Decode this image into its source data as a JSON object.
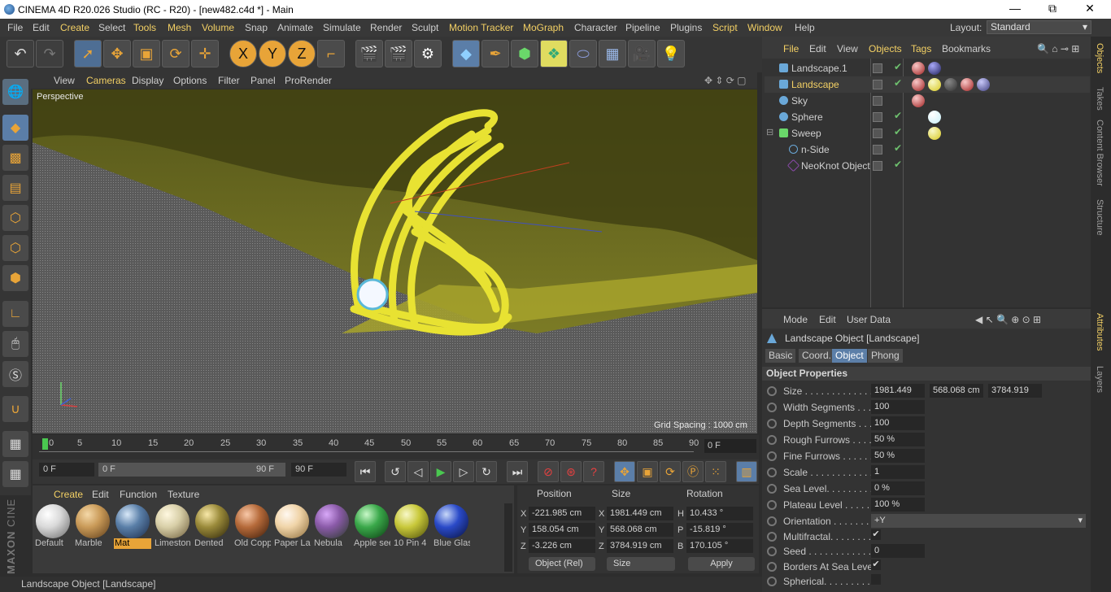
{
  "window": {
    "title": "CINEMA 4D R20.026 Studio (RC - R20) - [new482.c4d *] - Main",
    "minimize": "—",
    "restore": "⧉",
    "close": "✕"
  },
  "menubar": {
    "items": [
      "File",
      "Edit",
      "Create",
      "Select",
      "Tools",
      "Mesh",
      "Volume",
      "Snap",
      "Animate",
      "Simulate",
      "Render",
      "Sculpt",
      "Motion Tracker",
      "MoGraph",
      "Character",
      "Pipeline",
      "Plugins",
      "Script",
      "Window",
      "Help"
    ],
    "layout_label": "Layout:",
    "layout_value": "Standard"
  },
  "toolbar": {
    "icons": [
      "undo-icon",
      "redo-icon",
      "live-select-icon",
      "move-icon",
      "scale-icon",
      "rotate-icon",
      "last-tool-icon",
      "x-axis-icon",
      "y-axis-icon",
      "z-axis-icon",
      "coordinate-system-icon",
      "render-view-icon",
      "render-to-picture-viewer-icon",
      "edit-render-settings-icon",
      "cube-icon",
      "pen-icon",
      "subdivision-icon",
      "array-icon",
      "deformer-icon",
      "floor-icon",
      "camera-icon",
      "light-icon"
    ]
  },
  "viewport": {
    "menu": [
      "View",
      "Cameras",
      "Display",
      "Options",
      "Filter",
      "Panel",
      "ProRender"
    ],
    "camera_label": "Perspective",
    "grid_spacing": "Grid Spacing : 1000 cm"
  },
  "timeline": {
    "ticks": [
      "0",
      "5",
      "10",
      "15",
      "20",
      "25",
      "30",
      "35",
      "40",
      "45",
      "50",
      "55",
      "60",
      "65",
      "70",
      "75",
      "80",
      "85",
      "90"
    ],
    "current_frame": "0 F"
  },
  "playbar": {
    "start": "0 F",
    "range_start": "0 F",
    "range_end": "90 F",
    "end": "90 F"
  },
  "material_manager": {
    "menu": [
      "Create",
      "Edit",
      "Function",
      "Texture"
    ],
    "materials": [
      {
        "name": "Default",
        "color": "#d9d9d9"
      },
      {
        "name": "Marble",
        "color": "#c99a58"
      },
      {
        "name": "Mat",
        "color": "#5a7fa8"
      },
      {
        "name": "Limestone",
        "color": "#d8cfa8"
      },
      {
        "name": "Dented",
        "color": "#9a8a3a"
      },
      {
        "name": "Old Copper",
        "color": "#b56a3a"
      },
      {
        "name": "Paper Lamp",
        "color": "#f0d4a8"
      },
      {
        "name": "Nebula",
        "color": "#8a5aa8"
      },
      {
        "name": "Apple seed",
        "color": "#3aa84a"
      },
      {
        "name": "10 Pin 4",
        "color": "#c8c83a"
      },
      {
        "name": "Blue Glass",
        "color": "#2a4ac8"
      }
    ],
    "selected": "Mat"
  },
  "coordinates": {
    "headers": [
      "Position",
      "Size",
      "Rotation"
    ],
    "rows": [
      {
        "axis": "X",
        "pos": "-221.985 cm",
        "size_axis": "X",
        "size": "1981.449 cm",
        "rot_axis": "H",
        "rot": "10.433 °"
      },
      {
        "axis": "Y",
        "pos": "158.054 cm",
        "size_axis": "Y",
        "size": "568.068 cm",
        "rot_axis": "P",
        "rot": "-15.819 °"
      },
      {
        "axis": "Z",
        "pos": "-3.226 cm",
        "size_axis": "Z",
        "size": "3784.919 cm",
        "rot_axis": "B",
        "rot": "170.105 °"
      }
    ],
    "mode": "Object (Rel)",
    "size_mode": "Size",
    "apply": "Apply"
  },
  "status": "Landscape Object [Landscape]",
  "object_manager": {
    "menu": [
      "File",
      "Edit",
      "View",
      "Objects",
      "Tags",
      "Bookmarks"
    ],
    "objects": [
      {
        "name": "Landscape.1",
        "indent": 0,
        "icon_color": "#6aa8d8",
        "highlight": false,
        "tags": [
          "#a02020",
          "#20205a"
        ]
      },
      {
        "name": "Landscape",
        "indent": 0,
        "icon_color": "#6aa8d8",
        "highlight": true,
        "tags": [
          "#a02020",
          "#d8c820",
          "#303030",
          "#a02020",
          "#404080"
        ]
      },
      {
        "name": "Sky",
        "indent": 0,
        "icon_color": "#6aa8d8",
        "highlight": false,
        "tags": [
          "#a02020"
        ]
      },
      {
        "name": "Sphere",
        "indent": 0,
        "icon_color": "#6aa8d8",
        "highlight": false,
        "tags": [
          "#c8f0f8"
        ]
      },
      {
        "name": "Sweep",
        "indent": 0,
        "icon_color": "#6ad86a",
        "highlight": false,
        "tags": [
          "#d8c820"
        ]
      },
      {
        "name": "n-Side",
        "indent": 1,
        "icon_color": "#6aa8d8",
        "highlight": false,
        "tags": []
      },
      {
        "name": "NeoKnot Object",
        "indent": 1,
        "icon_color": "#8a4aa8",
        "highlight": false,
        "tags": []
      }
    ]
  },
  "attributes": {
    "menu": [
      "Mode",
      "Edit",
      "User Data"
    ],
    "object_title": "Landscape Object [Landscape]",
    "tabs": [
      "Basic",
      "Coord.",
      "Object",
      "Phong"
    ],
    "active_tab": "Object",
    "section": "Object Properties",
    "props": [
      {
        "label": "Size . . . . . . . . . . . . . . .",
        "values": [
          "1981.449",
          "568.068 cm",
          "3784.919"
        ]
      },
      {
        "label": "Width Segments . . .",
        "values": [
          "100"
        ]
      },
      {
        "label": "Depth Segments . . .",
        "values": [
          "100"
        ]
      },
      {
        "label": "Rough Furrows . . . .",
        "values": [
          "50 %"
        ]
      },
      {
        "label": "Fine Furrows . . . . . .",
        "values": [
          "50 %"
        ]
      },
      {
        "label": "Scale . . . . . . . . . . . .",
        "values": [
          "1"
        ]
      },
      {
        "label": "Sea Level. . . . . . . . .",
        "values": [
          "0 %"
        ]
      },
      {
        "label": "Plateau Level . . . . .",
        "values": [
          "100 %"
        ]
      },
      {
        "label": "Orientation . . . . . . .",
        "values": [
          "+Y"
        ]
      },
      {
        "label": "Multifractal. . . . . . . .",
        "check": "✔"
      },
      {
        "label": "Seed . . . . . . . . . . . . .",
        "values": [
          "0"
        ]
      },
      {
        "label": "Borders At Sea Level",
        "check": "✔"
      },
      {
        "label": "Spherical. . . . . . . . . .",
        "check": ""
      }
    ]
  },
  "sidetabs": [
    "Objects",
    "Takes",
    "Content Browser",
    "Structure",
    "Attributes",
    "Layers"
  ]
}
